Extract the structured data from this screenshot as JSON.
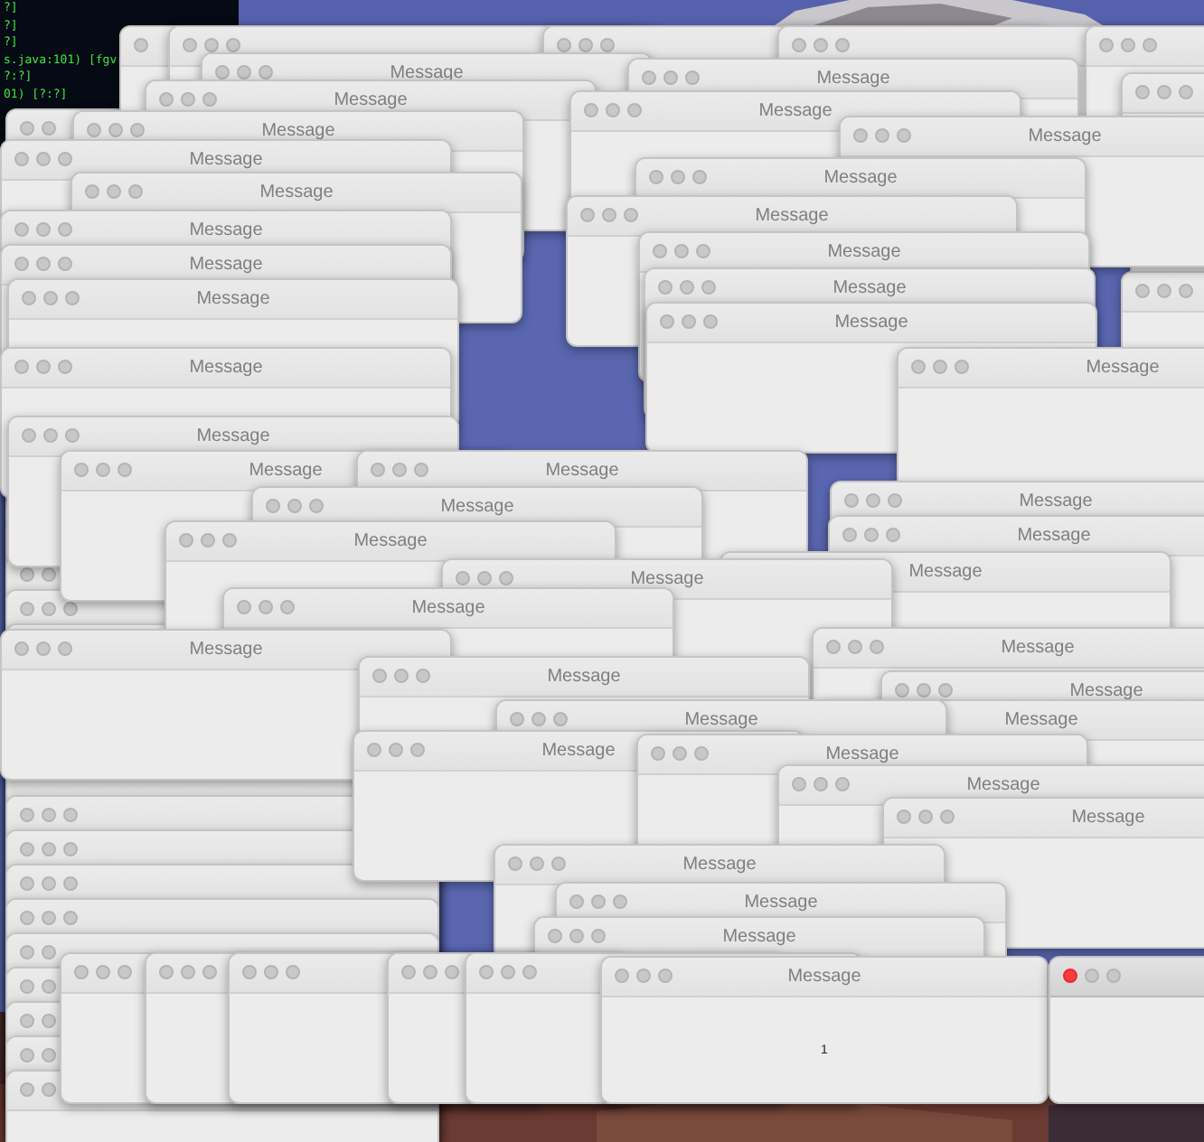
{
  "terminal": {
    "lines": [
      "?]",
      "?]",
      "?]",
      "s.java:101) [fgv",
      "?:?]",
      "01) [?:?]"
    ]
  },
  "windows": [
    {
      "kind": "covered"
    },
    {
      "kind": "covered"
    },
    {
      "kind": "covered"
    },
    {
      "kind": "covered"
    },
    {
      "kind": "covered"
    },
    {
      "kind": "covered"
    },
    {
      "kind": "covered"
    },
    {
      "kind": "covered"
    },
    {
      "kind": "covered"
    },
    {
      "kind": "covered"
    },
    {
      "kind": "covered"
    },
    {
      "kind": "covered"
    },
    {
      "kind": "covered"
    },
    {
      "kind": "covered"
    },
    {
      "kind": "covered"
    },
    {
      "kind": "covered"
    },
    {
      "kind": "covered"
    },
    {
      "kind": "covered"
    },
    {
      "kind": "covered"
    },
    {
      "kind": "covered"
    },
    {
      "kind": "covered"
    },
    {
      "kind": "covered"
    },
    {
      "kind": "covered"
    },
    {
      "kind": "covered"
    },
    {
      "kind": "covered"
    },
    {
      "kind": "covered"
    },
    {
      "kind": "covered"
    },
    {
      "kind": "covered"
    },
    {
      "kind": "covered"
    },
    {
      "kind": "covered"
    },
    {
      "kind": "covered"
    },
    {
      "kind": "covered"
    },
    {
      "kind": "covered"
    },
    {
      "kind": "covered"
    },
    {
      "kind": "message",
      "title": "Message"
    },
    {
      "kind": "message",
      "title": "Message"
    },
    {
      "kind": "message",
      "title": "Message"
    },
    {
      "kind": "message",
      "title": "Message"
    },
    {
      "kind": "message",
      "title": "Message"
    },
    {
      "kind": "message",
      "title": "Message"
    },
    {
      "kind": "message",
      "title": "Message"
    },
    {
      "kind": "message",
      "title": "Message"
    },
    {
      "kind": "message",
      "title": "Message"
    },
    {
      "kind": "message",
      "title": "Message"
    },
    {
      "kind": "message",
      "title": "Message"
    },
    {
      "kind": "message",
      "title": "Message"
    },
    {
      "kind": "message",
      "title": "Message"
    },
    {
      "kind": "message",
      "title": "Message"
    },
    {
      "kind": "message",
      "title": "Message"
    },
    {
      "kind": "message",
      "title": "Message"
    },
    {
      "kind": "message",
      "title": "Message"
    },
    {
      "kind": "message",
      "title": "Message"
    },
    {
      "kind": "message",
      "title": "Message"
    },
    {
      "kind": "message",
      "title": "Message"
    },
    {
      "kind": "message",
      "title": "Message"
    },
    {
      "kind": "message",
      "title": "Message"
    },
    {
      "kind": "message",
      "title": "Message"
    },
    {
      "kind": "message",
      "title": "Message"
    },
    {
      "kind": "message",
      "title": "Message"
    },
    {
      "kind": "message",
      "title": "Message"
    },
    {
      "kind": "message",
      "title": "Message"
    },
    {
      "kind": "message",
      "title": "Message"
    },
    {
      "kind": "message",
      "title": "Message"
    },
    {
      "kind": "message",
      "title": "Message"
    },
    {
      "kind": "message",
      "title": "Message"
    },
    {
      "kind": "message",
      "title": "Message"
    },
    {
      "kind": "message",
      "title": "Message"
    },
    {
      "kind": "message",
      "title": "Message"
    },
    {
      "kind": "message",
      "title": "Message"
    },
    {
      "kind": "message",
      "title": "Message"
    },
    {
      "kind": "message",
      "title": "Message"
    },
    {
      "kind": "message",
      "title": "Message"
    },
    {
      "kind": "message",
      "title": "Message"
    },
    {
      "kind": "message",
      "title": "Message"
    },
    {
      "kind": "message",
      "title": "Message"
    },
    {
      "kind": "covered"
    },
    {
      "kind": "covered"
    },
    {
      "kind": "covered"
    },
    {
      "kind": "covered"
    },
    {
      "kind": "covered"
    },
    {
      "kind": "message",
      "title": "Message",
      "body": "1"
    }
  ],
  "front_window": {
    "active": true
  }
}
